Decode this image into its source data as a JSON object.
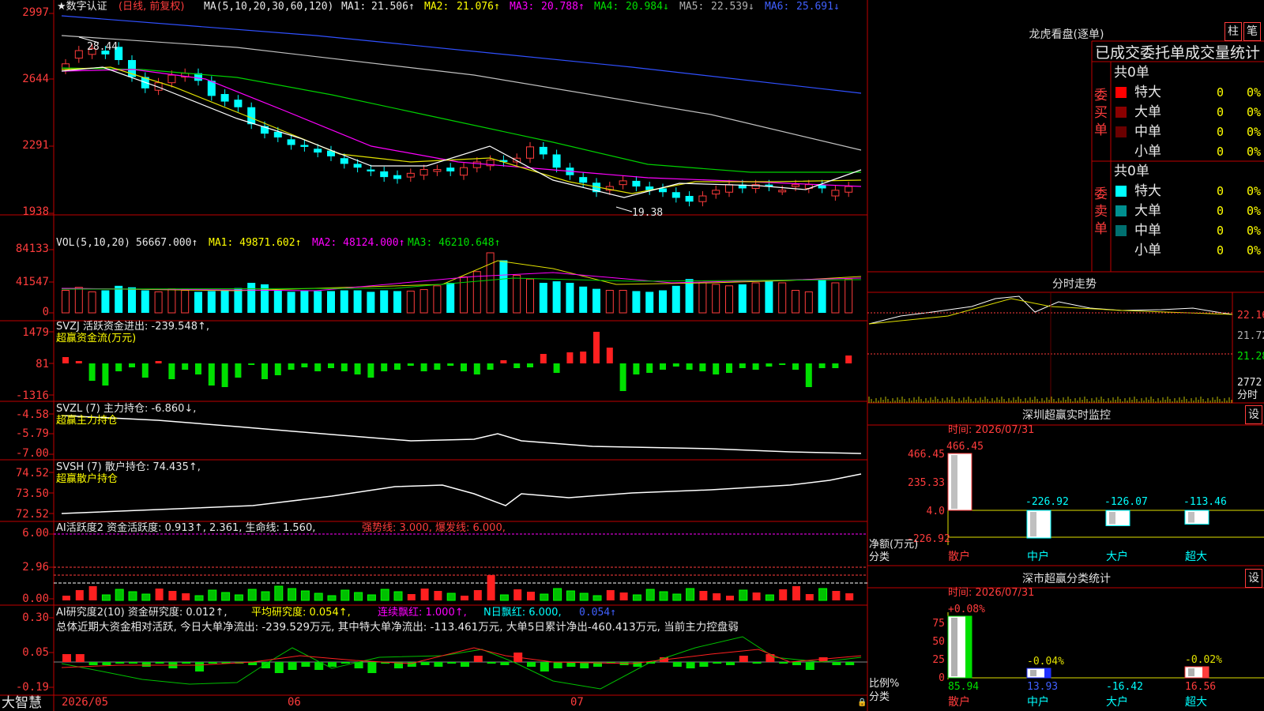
{
  "app": {
    "name": "大智慧"
  },
  "main_panel": {
    "title_star": "★数字认证",
    "title_mode": "(日线, 前复权)",
    "ma_params": "MA(5,10,20,30,60,120)",
    "ma_values": [
      {
        "label": "MA1:",
        "value": "21.506↑"
      },
      {
        "label": "MA2:",
        "value": "21.076↑"
      },
      {
        "label": "MA3:",
        "value": "20.788↑"
      },
      {
        "label": "MA4:",
        "value": "20.984↓"
      },
      {
        "label": "MA5:",
        "value": "22.539↓"
      },
      {
        "label": "MA6:",
        "value": "25.691↓"
      }
    ],
    "y_ticks": [
      "2997",
      "2644",
      "2291",
      "1938"
    ],
    "high_annotation": "28.44",
    "low_annotation": "19.38"
  },
  "vol_panel": {
    "label": "VOL(5,10,20)",
    "value": "56667.000↑",
    "ma1": "MA1: 49871.602↑",
    "ma2": "MA2: 48124.000↑",
    "ma3": "MA3: 46210.648↑",
    "y_ticks": [
      "84133",
      "41547",
      "0"
    ]
  },
  "svzj_panel": {
    "label": "SVZJ  活跃资金进出: -239.548↑,",
    "subtitle": "超赢资金流(万元)",
    "y_ticks": [
      "1479",
      "81",
      "-1316"
    ]
  },
  "svzl_panel": {
    "label": "SVZL (7) 主力持仓: -6.860↓,",
    "subtitle": "超赢主力持仓",
    "y_ticks": [
      "-4.58",
      "-5.79",
      "-7.00"
    ]
  },
  "svsh_panel": {
    "label": "SVSH (7) 散户持仓: 74.435↑,",
    "subtitle": "超赢散户持仓",
    "y_ticks": [
      "74.52",
      "73.50",
      "72.52"
    ]
  },
  "ai_active_panel": {
    "label_a": "AI活跃度2 资金活跃度: 0.913↑, 2.361, 生命线: 1.560,",
    "label_b": "强势线: 3.000, 爆发线: 6.000,",
    "y_ticks": [
      "6.00",
      "2.96",
      "0.00"
    ]
  },
  "ai_research_panel": {
    "label_a": "AI研究度2(10) 资金研究度: 0.012↑,",
    "label_b": "平均研究度: 0.054↑,",
    "label_c": "连续飘红: 1.000↑,",
    "label_d": "N日飘红: 6.000,",
    "label_e": "0.054↑",
    "summary": "总体近期大资金相对活跃, 今日大单净流出: -239.529万元, 其中特大单净流出: -113.461万元, 大单5日累计净出-460.413万元, 当前主力控盘弱",
    "y_ticks": [
      "0.30",
      "0.05",
      "-0.19"
    ]
  },
  "x_axis": {
    "labels": [
      "2026/05",
      "06",
      "07"
    ]
  },
  "dragon_tiger": {
    "title": "龙虎看盘(逐单)",
    "btn_bar": "柱",
    "btn_stroke": "笔",
    "header": "已成交委托单成交量统计",
    "buy_label": "委买单",
    "sell_label": "委卖单",
    "buy_total": "共0单",
    "sell_total": "共0单",
    "buy_rows": [
      {
        "name": "特大",
        "count": "0",
        "pct": "0%",
        "color": "#ff0000"
      },
      {
        "name": "大单",
        "count": "0",
        "pct": "0%",
        "color": "#8b0000"
      },
      {
        "name": "中单",
        "count": "0",
        "pct": "0%",
        "color": "#6b0000"
      },
      {
        "name": "小单",
        "count": "0",
        "pct": "0%",
        "color": "#000000"
      }
    ],
    "sell_rows": [
      {
        "name": "特大",
        "count": "0",
        "pct": "0%",
        "color": "#00ffff"
      },
      {
        "name": "大单",
        "count": "0",
        "pct": "0%",
        "color": "#009090"
      },
      {
        "name": "中单",
        "count": "0",
        "pct": "0%",
        "color": "#007070"
      },
      {
        "name": "小单",
        "count": "0",
        "pct": "0%",
        "color": "#000000"
      }
    ]
  },
  "intraday": {
    "title": "分时走势",
    "y_ticks": [
      "22.16",
      "21.72",
      "21.28"
    ],
    "vol_tick": "2772",
    "vol_unit": "分时"
  },
  "sz_monitor": {
    "title": "深圳超赢实时监控",
    "set_btn": "设",
    "time_label": "时间: 2026/07/31",
    "y_ticks": [
      "466.45",
      "235.33",
      "4.0",
      "-226.92"
    ],
    "unit_label": "净额(万元)",
    "cat_label": "分类",
    "bars": [
      {
        "name": "散户",
        "value": 466.45,
        "label": "466.45"
      },
      {
        "name": "中户",
        "value": -226.92,
        "label": "-226.92"
      },
      {
        "name": "大户",
        "value": -126.07,
        "label": "-126.07"
      },
      {
        "name": "超大",
        "value": -113.46,
        "label": "-113.46"
      }
    ]
  },
  "sz_category": {
    "title": "深市超赢分类统计",
    "set_btn": "设",
    "time_label": "时间: 2026/07/31",
    "y_ticks": [
      "75",
      "50",
      "25",
      "0"
    ],
    "ratio_label": "比例%",
    "cat_label": "分类",
    "bars": [
      {
        "name": "散户",
        "pct": "+0.08%",
        "value": "85.94"
      },
      {
        "name": "中户",
        "pct": "-0.04%",
        "value": "13.93"
      },
      {
        "name": "大户",
        "pct": "",
        "value": "-16.42"
      },
      {
        "name": "超大",
        "pct": "-0.02%",
        "value": "16.56"
      }
    ]
  }
}
